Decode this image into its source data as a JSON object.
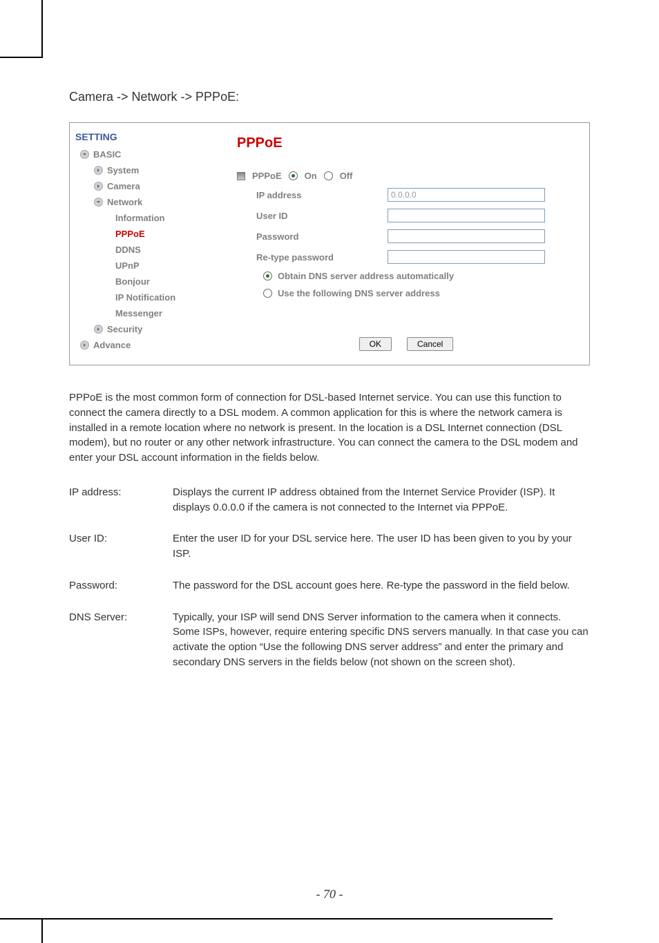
{
  "heading": "Camera -> Network -> PPPoE:",
  "sidebar": {
    "setting": "SETTING",
    "basic": "BASIC",
    "system": "System",
    "camera": "Camera",
    "network": "Network",
    "information": "Information",
    "pppoe": "PPPoE",
    "ddns": "DDNS",
    "upnp": "UPnP",
    "bonjour": "Bonjour",
    "ipnotification": "IP Notification",
    "messenger": "Messenger",
    "security": "Security",
    "advance": "Advance"
  },
  "panel": {
    "title": "PPPoE",
    "pppoe_label": "PPPoE",
    "on_label": "On",
    "off_label": "Off",
    "ip_label": "IP address",
    "ip_value": "0.0.0.0",
    "userid_label": "User ID",
    "password_label": "Password",
    "retype_label": "Re-type password",
    "dns_auto": "Obtain DNS server address automatically",
    "dns_manual": "Use the following DNS server address",
    "ok": "OK",
    "cancel": "Cancel"
  },
  "body_para": "PPPoE is the most common form of connection for DSL-based Internet service. You can use this function to connect the camera directly to a DSL modem. A common application for this is where the network camera is installed in a remote location where no network is present. In the location is a DSL Internet connection (DSL modem), but no router or any other network infrastructure. You can connect the camera to the DSL modem and enter your DSL account information in the fields below.",
  "defs": {
    "ip_label": "IP address:",
    "ip_text": "Displays the current IP address obtained from the Internet Service Provider (ISP). It displays 0.0.0.0 if the camera is not connected to the Internet via PPPoE.",
    "userid_label": "User ID:",
    "userid_text": "Enter the user ID for your DSL service here. The user ID has been given to you by your ISP.",
    "password_label": "Password:",
    "password_text": "The password for the DSL account goes here. Re-type the password in the field below.",
    "dns_label": "DNS Server:",
    "dns_text": "Typically, your ISP will send DNS Server information to the camera when it connects. Some ISPs, however, require entering specific DNS servers manually. In that case you can activate the option “Use the following DNS server address” and enter the primary and secondary DNS servers in the fields below (not shown on the screen shot)."
  },
  "page_number": "- 70 -"
}
